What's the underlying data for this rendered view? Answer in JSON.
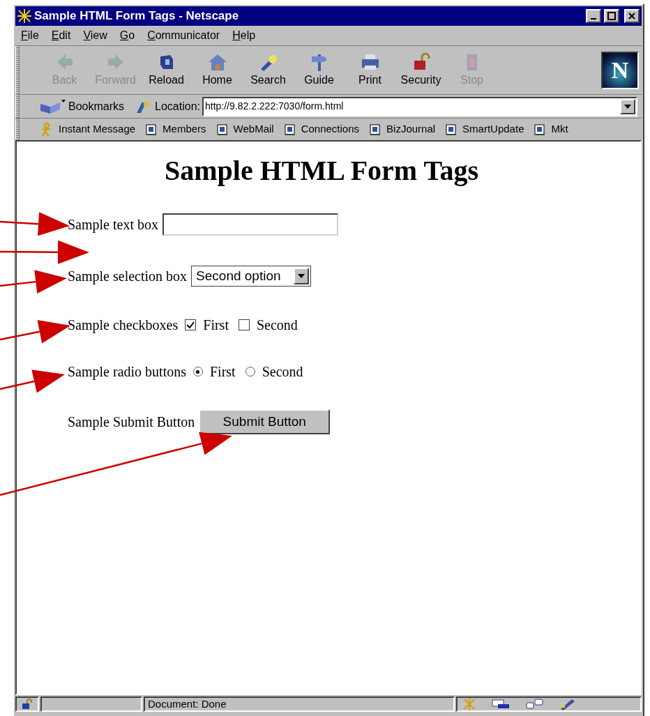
{
  "window": {
    "title": "Sample HTML Form Tags - Netscape"
  },
  "menu": [
    "File",
    "Edit",
    "View",
    "Go",
    "Communicator",
    "Help"
  ],
  "toolbar": [
    {
      "label": "Back",
      "disabled": true
    },
    {
      "label": "Forward",
      "disabled": true
    },
    {
      "label": "Reload",
      "disabled": false
    },
    {
      "label": "Home",
      "disabled": false
    },
    {
      "label": "Search",
      "disabled": false
    },
    {
      "label": "Guide",
      "disabled": false
    },
    {
      "label": "Print",
      "disabled": false
    },
    {
      "label": "Security",
      "disabled": false
    },
    {
      "label": "Stop",
      "disabled": true
    }
  ],
  "logo": "N",
  "location_bar": {
    "bookmarks": "Bookmarks",
    "label": "Location:",
    "url": "http://9.82.2.222:7030/form.html"
  },
  "personal_toolbar": [
    {
      "label": "Instant Message",
      "kind": "person"
    },
    {
      "label": "Members",
      "kind": "page"
    },
    {
      "label": "WebMail",
      "kind": "page"
    },
    {
      "label": "Connections",
      "kind": "page"
    },
    {
      "label": "BizJournal",
      "kind": "page"
    },
    {
      "label": "SmartUpdate",
      "kind": "page"
    },
    {
      "label": "Mkt",
      "kind": "page"
    }
  ],
  "page": {
    "heading": "Sample HTML Form Tags",
    "rows": [
      {
        "kind": "text",
        "label": "Sample text box"
      },
      {
        "kind": "select",
        "label": "Sample selection box",
        "value": "Second option"
      },
      {
        "kind": "checkbox",
        "label": "Sample checkboxes",
        "options": [
          {
            "label": "First",
            "checked": true
          },
          {
            "label": "Second",
            "checked": false
          }
        ]
      },
      {
        "kind": "radio",
        "label": "Sample radio buttons",
        "options": [
          {
            "label": "First",
            "selected": true
          },
          {
            "label": "Second",
            "selected": false
          }
        ]
      },
      {
        "kind": "submit",
        "label": "Sample Submit Button",
        "button": "Submit Button"
      }
    ]
  },
  "status_bar": {
    "text": "Document: Done"
  }
}
